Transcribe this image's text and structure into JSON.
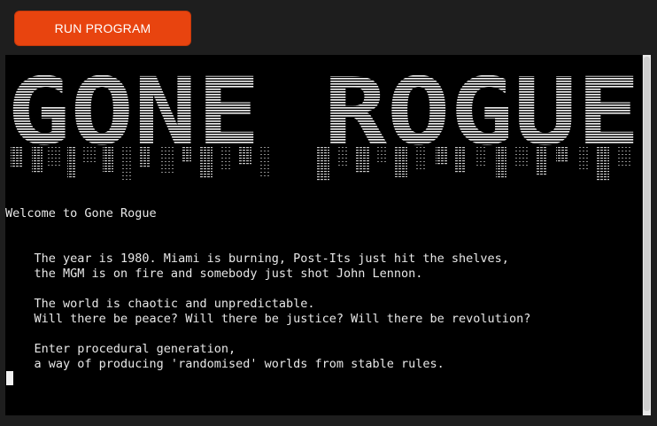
{
  "toolbar": {
    "run_label": "RUN PROGRAM"
  },
  "terminal": {
    "banner_text": "GONE ROGUE",
    "lines": [
      "Welcome to Gone Rogue",
      "",
      "",
      "    The year is 1980. Miami is burning, Post-Its just hit the shelves,",
      "    the MGM is on fire and somebody just shot John Lennon.",
      "",
      "    The world is chaotic and unpredictable.",
      "    Will there be peace? Will there be justice? Will there be revolution?",
      "",
      "    Enter procedural generation,",
      "    a way of producing 'randomised' worlds from stable rules."
    ]
  },
  "colors": {
    "accent": "#e8440f",
    "terminal_bg": "#000000",
    "terminal_text": "#e8e8e8",
    "page_bg": "#1e1e1e"
  }
}
